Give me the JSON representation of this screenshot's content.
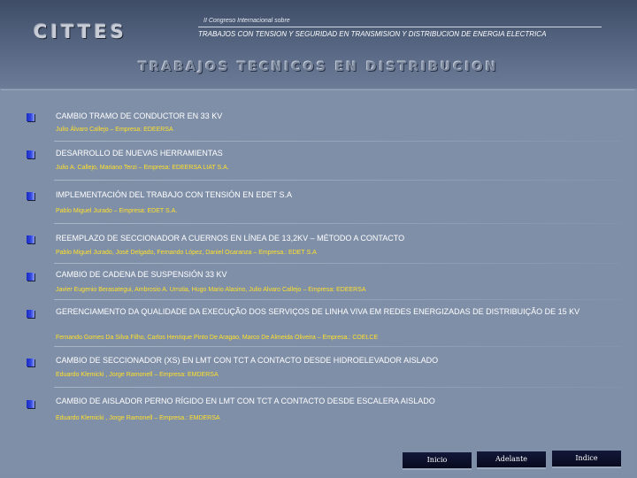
{
  "header": {
    "brand": "CITTES",
    "congress": "II Congreso Internacional sobre",
    "subtitle": "TRABAJOS CON TENSION Y SEGURIDAD EN TRANSMISION Y DISTRIBUCION DE ENERGIA ELECTRICA",
    "section_title": "TRABAJOS TECNICOS EN DISTRIBUCION"
  },
  "papers": [
    {
      "title": "CAMBIO  TRAMO  DE  CONDUCTOR  EN  33 KV",
      "authors": "Julio  Álvaro  Callejo – Empresa: EDEERSA"
    },
    {
      "title": "DESARROLLO  DE  NUEVAS  HERRAMIENTAS",
      "authors": "Julio A. Callejo, Mariano  Terzi –  Empresa:  EDEERSA LIAT  S.A."
    },
    {
      "title": "IMPLEMENTACIÓN DEL TRABAJO CON TENSIÓN EN EDET S.A",
      "authors": "Pablo Miguel Jurado – Empresa: EDET S.A."
    },
    {
      "title": "REEMPLAZO DE SECCIONADOR A CUERNOS EN LÍNEA DE 13,2KV – MÉTODO A CONTACTO",
      "authors": "Pablo Miguel Jurado, José Delgado, Fernando López, Daniel Ocaranza – Empresa.: EDET S.A"
    },
    {
      "title": "CAMBIO DE CADENA DE SUSPENSIÓN  33  KV",
      "authors": "Javier Eugenio Berasategui, Ambrosio A. Urrutia, Hugo  Mario  Alasino, Julio  Alvaro Callejo – Empresa:  EDEERSA"
    },
    {
      "title": "GERENCIAMENTO DA QUALIDADE DA EXECUÇÃO DOS SERVIÇOS DE LINHA VIVA EM REDES ENERGIZADAS DE DISTRIBUIÇÃO DE 15 KV",
      "authors": "Fernando Gomes Da Silva Filho, Carlos Henrique Pinto De Aragao, Marco De Almeida Oliveira – Empresa.: COELCE"
    },
    {
      "title": "CAMBIO DE SECCIONADOR (XS) EN LMT CON TCT A CONTACTO DESDE HIDROELEVADOR AISLADO",
      "authors": "Eduardo Klemicki , Jorge Ramonell – Empresa: EMDERSA"
    },
    {
      "title": "CAMBIO DE AISLADOR PERNO RÍGIDO EN LMT CON TCT A CONTACTO DESDE ESCALERA AISLADO",
      "authors": "Eduardo Klemicki , Jorge Ramonell – Empresa.: EMDERSA"
    }
  ],
  "nav": {
    "inicio": "Inicio",
    "adelante": "Adelante",
    "indice": "Indice"
  }
}
